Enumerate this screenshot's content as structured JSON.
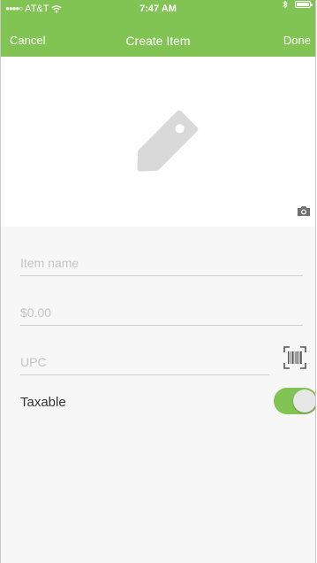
{
  "status_bar": {
    "carrier": "AT&T",
    "time": "7:47 AM"
  },
  "nav": {
    "cancel_label": "Cancel",
    "title": "Create Item",
    "done_label": "Done"
  },
  "form": {
    "item_name": {
      "value": "",
      "placeholder": "Item name"
    },
    "price": {
      "value": "",
      "placeholder": "$0.00"
    },
    "upc": {
      "value": "",
      "placeholder": "UPC"
    },
    "taxable": {
      "label": "Taxable",
      "enabled": true
    }
  },
  "colors": {
    "accent": "#82c454",
    "placeholder": "#c4c4c4",
    "tag_icon": "#d9d9d9"
  },
  "icons": [
    "signal-dots-icon",
    "wifi-icon",
    "bluetooth-icon",
    "battery-icon",
    "tag-icon",
    "camera-icon",
    "barcode-scan-icon"
  ]
}
